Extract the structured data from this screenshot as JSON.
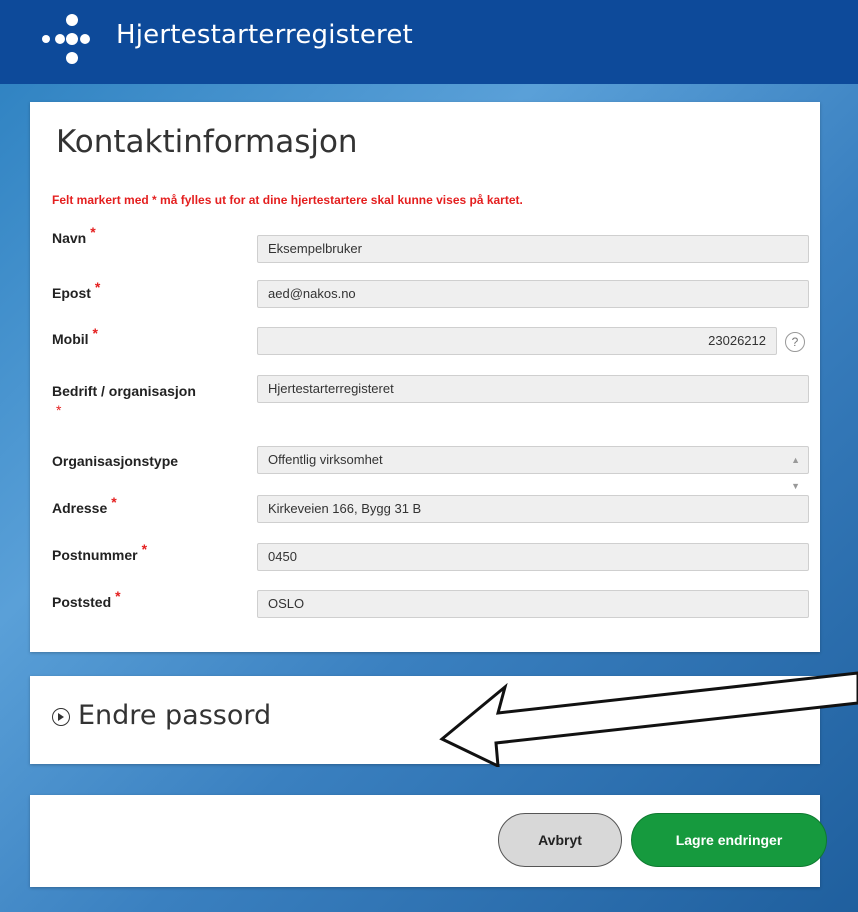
{
  "header": {
    "title": "Hjertestarterregisteret"
  },
  "contact": {
    "title": "Kontaktinformasjon",
    "notice": "Felt markert med * må fylles ut for at dine hjertestartere skal kunne vises på kartet.",
    "required_mark": "*",
    "fields": {
      "navn": {
        "label": "Navn",
        "value": "Eksempelbruker"
      },
      "epost": {
        "label": "Epost",
        "value": "aed@nakos.no"
      },
      "mobil": {
        "label": "Mobil",
        "value": "23026212"
      },
      "bedrift": {
        "label": "Bedrift / organisasjon",
        "value": "Hjertestarterregisteret"
      },
      "orgtype": {
        "label": "Organisasjonstype",
        "value": "Offentlig virksomhet"
      },
      "adresse": {
        "label": "Adresse",
        "value": "Kirkeveien 166, Bygg 31 B"
      },
      "postnummer": {
        "label": "Postnummer",
        "value": "0450"
      },
      "poststed": {
        "label": "Poststed",
        "value": "OSLO"
      }
    },
    "help_icon": "?"
  },
  "password": {
    "title": "Endre passord",
    "icon": "chevron-right-circle-icon"
  },
  "actions": {
    "cancel_label": "Avbryt",
    "save_label": "Lagre endringer"
  },
  "colors": {
    "header_bg": "#0d4a9a",
    "required": "#e41f1f",
    "save_button": "#169a3e",
    "cancel_button": "#d8d8d8"
  }
}
